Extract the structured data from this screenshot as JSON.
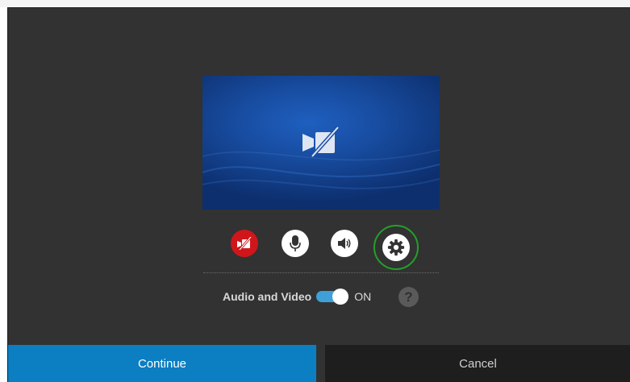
{
  "preview": {
    "icon": "video-off-icon"
  },
  "controls": [
    {
      "name": "video-toggle-button",
      "icon": "video-off-icon",
      "color": "#d0161b"
    },
    {
      "name": "microphone-button",
      "icon": "microphone-icon",
      "color": "#ffffff"
    },
    {
      "name": "speaker-button",
      "icon": "speaker-icon",
      "color": "#ffffff"
    },
    {
      "name": "settings-button",
      "icon": "gear-icon",
      "color": "#ffffff",
      "ring_color": "#23a02a"
    }
  ],
  "audio_video": {
    "label": "Audio and Video",
    "state": "ON",
    "enabled": true,
    "toggle_color": "#3fa0d8"
  },
  "help": {
    "glyph": "?"
  },
  "buttons": {
    "continue_label": "Continue",
    "cancel_label": "Cancel",
    "continue_color": "#0c7ec2"
  }
}
